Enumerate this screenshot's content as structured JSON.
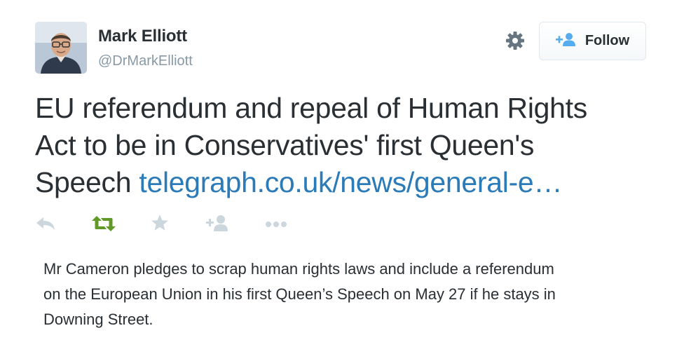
{
  "author": {
    "name": "Mark Elliott",
    "handle": "@DrMarkElliott",
    "avatar_icon": "profile-photo"
  },
  "header": {
    "settings_icon": "gear-icon",
    "follow_label": "Follow",
    "follow_icon": "add-user-icon"
  },
  "tweet": {
    "line1": "EU referendum and repeal of Human Rights",
    "line2": "Act to be in Conservatives' first Queen's",
    "line3_text": "Speech ",
    "link": "telegraph.co.uk/news/general-e…"
  },
  "actions": {
    "reply_icon": "reply-icon",
    "retweet_icon": "retweet-icon",
    "favorite_icon": "star-icon",
    "follow_icon": "add-user-icon",
    "more_icon": "more-icon",
    "colors": {
      "default": "#ccd6dd",
      "retweet": "#609928"
    }
  },
  "card": {
    "summary_line1": "Mr Cameron pledges to scrap human rights laws and include a referendum",
    "summary_line2": "on the European Union in his first Queen’s Speech on May 27 if he stays in",
    "summary_line3": "Downing Street."
  },
  "colors": {
    "text": "#292f33",
    "muted": "#8899a6",
    "link": "#2b7bb9",
    "follow_icon": "#55acee"
  }
}
